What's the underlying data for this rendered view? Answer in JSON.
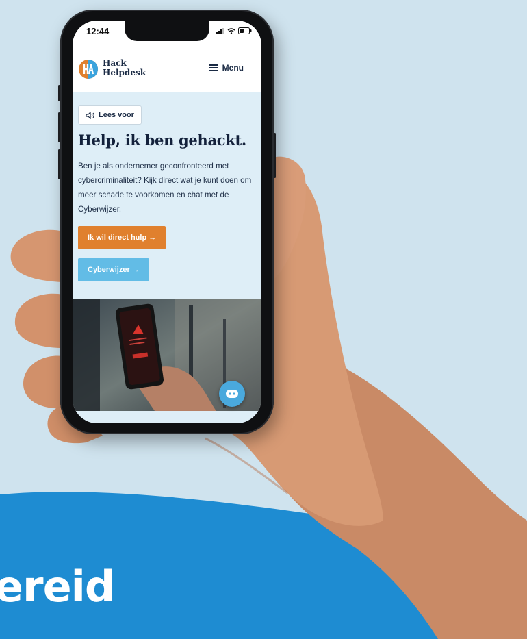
{
  "caption": {
    "text": "ereid"
  },
  "status_bar": {
    "time": "12:44"
  },
  "site": {
    "brand_line1": "Hack",
    "brand_line2": "Helpdesk",
    "menu_label": "Menu"
  },
  "hero": {
    "read_aloud": "Lees voor",
    "title": "Help, ik ben gehackt.",
    "body": "Ben je als ondernemer geconfronteerd met cybercriminaliteit? Kijk direct wat je kunt doen om meer schade te voorkomen en chat met de Cyberwijzer.",
    "primary_button": "Ik wil direct hulp →",
    "secondary_button": "Cyberwijzer →"
  },
  "colors": {
    "background": "#cfe3ee",
    "wave": "#1e8cd2",
    "brand_orange": "#e0802e",
    "brand_blue": "#62bce6",
    "navy": "#13213b",
    "hero_bg": "#deeef7"
  },
  "icons": [
    "speaker-icon",
    "menu-icon",
    "arrow-right-icon",
    "chatbot-icon",
    "warning-icon",
    "signal-icon",
    "wifi-icon",
    "battery-icon"
  ]
}
